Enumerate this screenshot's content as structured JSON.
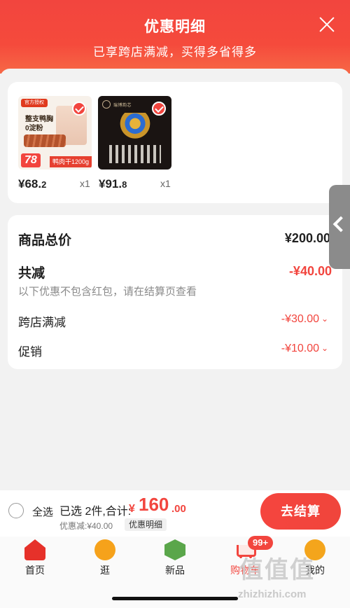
{
  "header": {
    "title": "优惠明细",
    "subtitle": "已享跨店满减，买得多省得多"
  },
  "items": [
    {
      "thumb_texts": [
        "官方授权",
        "整支鸭胸",
        "0淀粉",
        "78",
        "鸭肉干1200g"
      ],
      "price_int": "¥68.",
      "price_dec": "2",
      "qty": "x1",
      "selected": true
    },
    {
      "thumb_texts": [
        "瑞博韵芯"
      ],
      "price_int": "¥91.",
      "price_dec": "8",
      "qty": "x1",
      "selected": true
    }
  ],
  "summary": {
    "total_label": "商品总价",
    "total_value": "¥200.00",
    "reduce_label": "共减",
    "reduce_value": "-¥40.00",
    "reduce_note": "以下优惠不包含红包，请在结算页查看",
    "rows": [
      {
        "label": "跨店满减",
        "value": "-¥30.00",
        "chevron": "chevron-down-icon"
      },
      {
        "label": "促销",
        "value": "-¥10.00",
        "chevron": "chevron-down-icon"
      }
    ]
  },
  "bottom": {
    "select_all": "全选",
    "selected_text": "已选 2件,合计:",
    "total_yen": "¥",
    "total_int": "160",
    "total_dec": ".00",
    "discount_note": "优惠减:¥40.00",
    "detail_link": "优惠明细",
    "checkout": "去结算"
  },
  "tabbar": [
    {
      "label": "首页",
      "icon": "home-icon"
    },
    {
      "label": "逛",
      "icon": "stroll-icon"
    },
    {
      "label": "新品",
      "icon": "new-products-icon"
    },
    {
      "label": "购物车",
      "icon": "cart-icon",
      "badge": "99+",
      "active": true
    },
    {
      "label": "我的",
      "icon": "me-icon"
    }
  ],
  "watermark": {
    "text": "值值值",
    "url": "zhizhizhi.com"
  },
  "colors": {
    "accent": "#f2453e",
    "background": "#f2f2f2"
  }
}
